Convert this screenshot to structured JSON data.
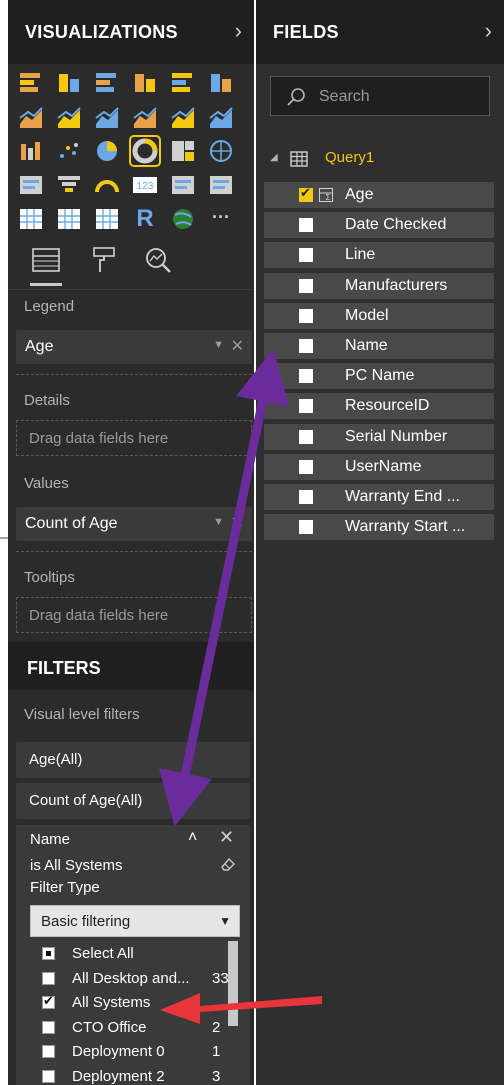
{
  "visualizations": {
    "title": "VISUALIZATIONS",
    "icons": [
      "stacked-bar-icon",
      "stacked-column-icon",
      "clustered-bar-icon",
      "clustered-column-icon",
      "100-bar-icon",
      "100-column-icon",
      "line-chart-icon",
      "area-chart-icon",
      "stacked-area-icon",
      "line-column-icon",
      "line-clustered-column-icon",
      "ribbon-chart-icon",
      "waterfall-icon",
      "scatter-icon",
      "pie-chart-icon",
      "donut-chart-icon",
      "treemap-icon",
      "map-icon",
      "filled-map-icon",
      "funnel-icon",
      "gauge-icon",
      "card-icon",
      "multirow-card-icon",
      "kpi-icon",
      "slicer-icon",
      "table-icon",
      "matrix-icon",
      "r-visual-icon",
      "globe-icon",
      "more-icon"
    ],
    "r_label": "R",
    "more_label": "···",
    "selected_index": 15
  },
  "tabs": [
    "fields-tab",
    "format-tab",
    "analytics-tab"
  ],
  "wells": {
    "legend_label": "Legend",
    "legend_value": "Age",
    "details_label": "Details",
    "details_placeholder": "Drag data fields here",
    "values_label": "Values",
    "values_value": "Count of Age",
    "tooltips_label": "Tooltips",
    "tooltips_placeholder": "Drag data fields here"
  },
  "filters": {
    "title": "FILTERS",
    "visual_level_label": "Visual level filters",
    "cards": [
      "Age(All)",
      "Count of Age(All)"
    ],
    "name_filter": {
      "name": "Name",
      "status": "is All Systems",
      "filter_type_label": "Filter Type",
      "mode": "Basic filtering",
      "values": [
        {
          "label": "Select All",
          "count": "",
          "state": "partial"
        },
        {
          "label": "All Desktop and...",
          "count": "33",
          "state": "unchecked"
        },
        {
          "label": "All Systems",
          "count": "",
          "state": "checked"
        },
        {
          "label": "CTO Office",
          "count": "2",
          "state": "unchecked"
        },
        {
          "label": "Deployment 0",
          "count": "1",
          "state": "unchecked"
        },
        {
          "label": "Deployment 2",
          "count": "3",
          "state": "unchecked"
        }
      ]
    }
  },
  "fields": {
    "title": "FIELDS",
    "search_placeholder": "Search",
    "table_name": "Query1",
    "items": [
      {
        "label": "Age",
        "checked": true,
        "sigma": true
      },
      {
        "label": "Date Checked",
        "checked": false
      },
      {
        "label": "Line",
        "checked": false
      },
      {
        "label": "Manufacturers",
        "checked": false
      },
      {
        "label": "Model",
        "checked": false
      },
      {
        "label": "Name",
        "checked": false
      },
      {
        "label": "PC Name",
        "checked": false
      },
      {
        "label": "ResourceID",
        "checked": false
      },
      {
        "label": "Serial Number",
        "checked": false
      },
      {
        "label": "UserName",
        "checked": false
      },
      {
        "label": "Warranty End ...",
        "checked": false
      },
      {
        "label": "Warranty Start ...",
        "checked": false
      }
    ]
  },
  "colors": {
    "accent": "#f2c811",
    "panel_bg": "#2b2b2b",
    "header_bg": "#1f1f1f",
    "annotation_purple": "#6a2c9a",
    "annotation_red": "#e8343a"
  }
}
